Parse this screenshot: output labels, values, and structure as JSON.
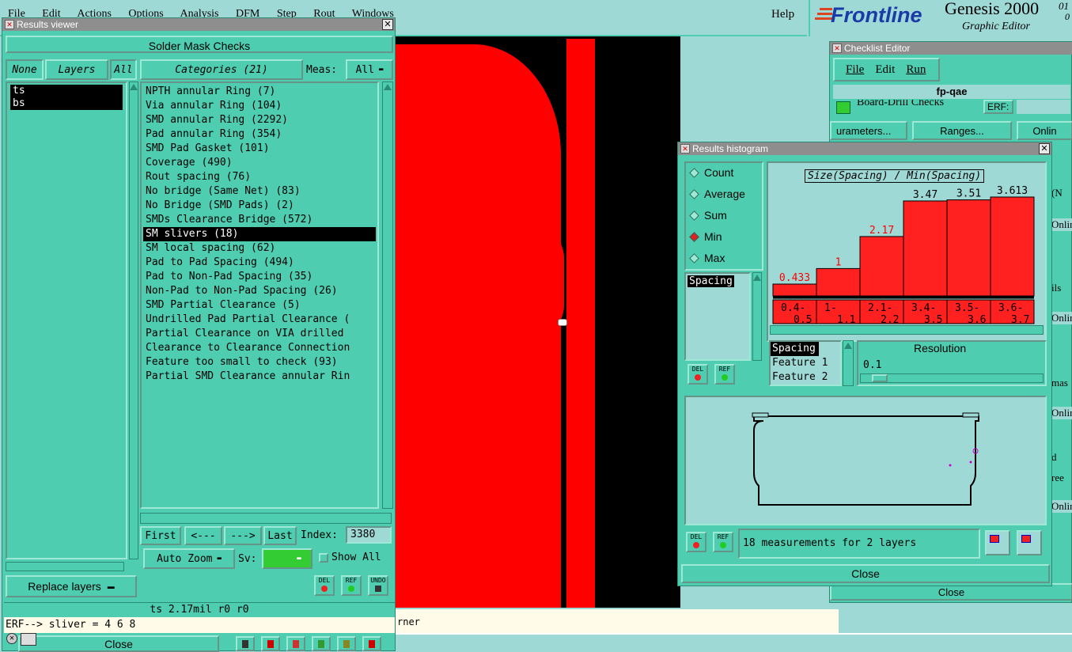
{
  "menubar": {
    "items": [
      "File",
      "Edit",
      "Actions",
      "Options",
      "Analysis",
      "DFM",
      "Step",
      "Rout",
      "Windows"
    ],
    "help": "Help"
  },
  "brand": {
    "logo": "Frontline",
    "product": "Genesis 2000",
    "subtitle": "Graphic Editor",
    "version_a": "01",
    "version_b": "0"
  },
  "results_viewer": {
    "title": "Results viewer",
    "header": "Solder Mask Checks",
    "none_btn": "None",
    "layers_btn": "Layers",
    "all_btn": "All",
    "layers": [
      "ts",
      "bs"
    ],
    "categories_btn": "Categories (21)",
    "meas_label": "Meas:",
    "meas_value": "All",
    "categories": [
      "NPTH annular Ring (7)",
      "Via annular Ring (104)",
      "SMD annular Ring (2292)",
      "Pad annular Ring (354)",
      "SMD Pad Gasket (101)",
      "Coverage (490)",
      "Rout spacing (76)",
      "No bridge (Same Net) (83)",
      "No Bridge (SMD Pads) (2)",
      "SMDs Clearance Bridge (572)",
      "SM slivers (18)",
      "SM local spacing (62)",
      "Pad to Pad Spacing (494)",
      "Pad to Non-Pad Spacing (35)",
      "Non-Pad to Non-Pad Spacing (26)",
      "SMD Partial Clearance (5)",
      "Undrilled Pad Partial Clearance (",
      "Partial Clearance on VIA drilled",
      "Clearance to Clearance Connection",
      "Feature too small to check (93)",
      "Partial SMD Clearance annular Rin"
    ],
    "selected_category": "SM slivers (18)",
    "first": "First",
    "prev": "<---",
    "next": "--->",
    "last": "Last",
    "index_label": "Index:",
    "index_value": "3380",
    "auto_zoom": "Auto Zoom",
    "sv_label": "Sv:",
    "show_all": "Show All",
    "replace_layers": "Replace layers",
    "del": "DEL",
    "ref": "REF",
    "undo": "UNDO",
    "status": "ts 2.17mil  r0  r0",
    "erf": "ERF--> sliver = 4 6 8",
    "close": "Close"
  },
  "checklist": {
    "title": "Checklist Editor",
    "menu": [
      "File",
      "Edit",
      "Run"
    ],
    "name": "fp-qae",
    "row": "Board-Drill Checks",
    "erf": "ERF:",
    "params": "urameters...",
    "ranges": "Ranges...",
    "online": "Onlin",
    "side_labels": [
      "(N",
      "Onlin",
      "ils",
      "Onlin",
      "mas",
      "Onlin",
      "d",
      "ree",
      "Onlin"
    ],
    "close": "Close"
  },
  "histogram": {
    "title": "Results histogram",
    "modes": [
      "Count",
      "Average",
      "Sum",
      "Min",
      "Max"
    ],
    "selected_mode": "Min",
    "measure_selected": "Spacing",
    "chart_title": "Size(Spacing) / Min(Spacing)",
    "attr_list": [
      "Spacing",
      "Feature 1",
      "Feature 2"
    ],
    "resolution_label": "Resolution",
    "resolution_value": "0.1",
    "summary": "18 measurements for 2 layers",
    "close": "Close",
    "del": "DEL",
    "ref": "REF"
  },
  "chart_data": {
    "type": "bar",
    "title": "Size(Spacing) / Min(Spacing)",
    "categories": [
      "0.4-0.5",
      "1-1.1",
      "2.1-2.2",
      "3.4-3.5",
      "3.5-3.6",
      "3.6-3.7"
    ],
    "category_lines": [
      [
        "0.4-",
        "0.5"
      ],
      [
        "1-",
        "1.1"
      ],
      [
        "2.1-",
        "2.2"
      ],
      [
        "3.4-",
        "3.5"
      ],
      [
        "3.5-",
        "3.6"
      ],
      [
        "3.6-",
        "3.7"
      ]
    ],
    "values": [
      0.433,
      1,
      2.17,
      3.47,
      3.51,
      3.613
    ],
    "value_labels": [
      "0.433",
      "1",
      "2.17",
      "3.47",
      "3.51",
      "3.613"
    ],
    "label_colors": [
      "#ff0000",
      "#ff0000",
      "#ff0000",
      "#000000",
      "#000000",
      "#000000"
    ],
    "ylim": [
      0,
      3.7
    ],
    "bar_color": "#ff2020"
  },
  "canvas": {
    "note": "rner"
  },
  "taskbar": {
    "icons": [
      "close-icon",
      "window-list-icon",
      "tool-1-icon",
      "tool-2-icon",
      "tool-3-icon",
      "tool-4-icon",
      "tool-5-icon",
      "chart-tool-icon"
    ]
  }
}
